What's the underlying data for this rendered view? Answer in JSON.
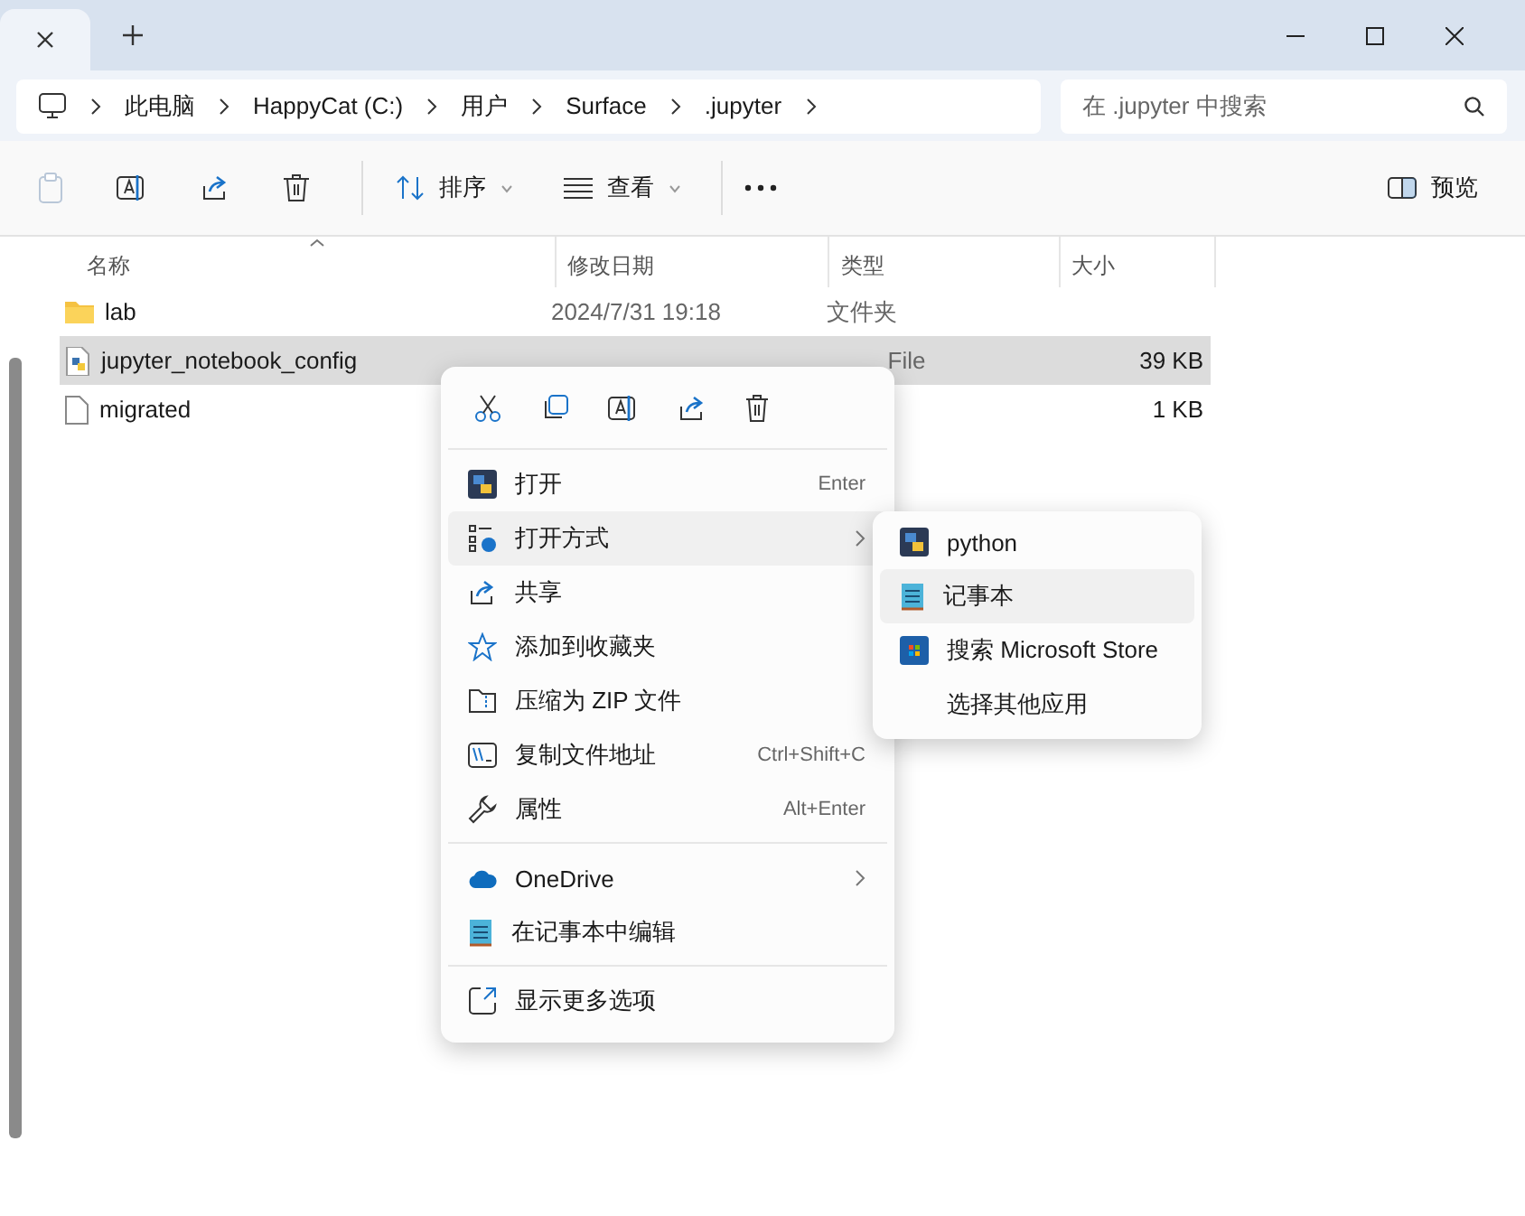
{
  "tabs": [
    {
      "selected": true
    }
  ],
  "address": {
    "crumbs": [
      "此电脑",
      "HappyCat (C:)",
      "用户",
      "Surface",
      ".jupyter"
    ]
  },
  "search": {
    "placeholder": "在 .jupyter 中搜索"
  },
  "toolbar": {
    "sort": "排序",
    "view": "查看",
    "preview": "预览"
  },
  "table": {
    "columns": [
      "名称",
      "修改日期",
      "类型",
      "大小"
    ],
    "rows": [
      {
        "kind": "folder",
        "name": "lab",
        "date": "2024/7/31 19:18",
        "type": "文件夹",
        "selected": false
      },
      {
        "kind": "python",
        "name": "jupyter_notebook_config",
        "type": "File",
        "size": "39 KB",
        "selected": true
      },
      {
        "kind": "file",
        "name": "migrated",
        "size": "1 KB",
        "selected": false
      }
    ]
  },
  "context_menu": {
    "groups": [
      [
        {
          "label": "打开",
          "shortcut": "Enter",
          "submenu": false,
          "highlighted": false
        },
        {
          "label": "打开方式",
          "submenu": true,
          "highlighted": true
        },
        {
          "label": "共享",
          "submenu": false,
          "highlighted": false
        },
        {
          "label": "添加到收藏夹",
          "submenu": false,
          "highlighted": false
        },
        {
          "label": "压缩为 ZIP 文件",
          "submenu": false,
          "highlighted": false
        },
        {
          "label": "复制文件地址",
          "shortcut": "Ctrl+Shift+C",
          "submenu": false,
          "highlighted": false
        },
        {
          "label": "属性",
          "shortcut": "Alt+Enter",
          "submenu": false,
          "highlighted": false
        }
      ],
      [
        {
          "label": "OneDrive",
          "submenu": true,
          "highlighted": false
        },
        {
          "label": "在记事本中编辑",
          "submenu": false,
          "highlighted": false
        }
      ],
      [
        {
          "label": "显示更多选项",
          "submenu": false,
          "highlighted": false
        }
      ]
    ]
  },
  "submenu": {
    "items": [
      {
        "label": "python",
        "highlighted": false
      },
      {
        "label": "记事本",
        "highlighted": true
      },
      {
        "label": "搜索 Microsoft Store",
        "highlighted": false
      },
      {
        "label": "选择其他应用",
        "highlighted": false
      }
    ]
  }
}
